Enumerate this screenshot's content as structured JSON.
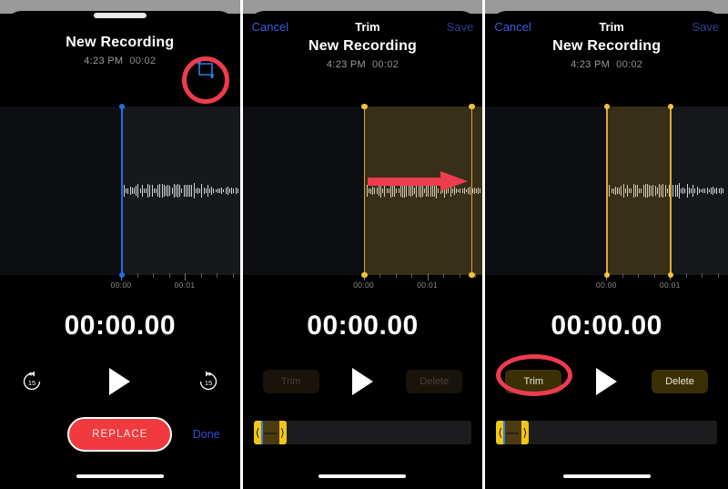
{
  "panels": [
    {
      "id": "playback",
      "navbar": {
        "visible": false,
        "cancel": "",
        "title": "",
        "save": ""
      },
      "header": {
        "title": "New Recording",
        "time": "4:23 PM",
        "duration": "00:02"
      },
      "crop_icon": {
        "name": "crop-trim-icon",
        "color": "#2f7de0",
        "annotated": true
      },
      "ruler": {
        "labels": [
          "00:00",
          "00:01"
        ]
      },
      "timer": "00:00.00",
      "transport": {
        "skip_back_label": "15",
        "skip_forward_label": "15",
        "play_label": "play"
      },
      "replace_label": "REPLACE",
      "done_label": "Done",
      "annotation": {
        "type": "ellipse",
        "color": "#ef3b4e",
        "target": "crop-trim-icon"
      }
    },
    {
      "id": "trim-drag",
      "navbar": {
        "visible": true,
        "cancel": "Cancel",
        "title": "Trim",
        "save": "Save"
      },
      "header": {
        "title": "New Recording",
        "time": "4:23 PM",
        "duration": "00:02"
      },
      "ruler": {
        "labels": [
          "00:00",
          "00:01"
        ]
      },
      "timer": "00:00.00",
      "transport": {
        "trim_label": "Trim",
        "delete_label": "Delete",
        "play_label": "play"
      },
      "annotation": {
        "type": "arrow",
        "color": "#ef3b4e",
        "direction": "right"
      }
    },
    {
      "id": "trim-ready",
      "navbar": {
        "visible": true,
        "cancel": "Cancel",
        "title": "Trim",
        "save": "Save"
      },
      "header": {
        "title": "New Recording",
        "time": "4:23 PM",
        "duration": "00:02"
      },
      "ruler": {
        "labels": [
          "00:00",
          "00:01"
        ]
      },
      "timer": "00:00.00",
      "transport": {
        "trim_label": "Trim",
        "delete_label": "Delete",
        "play_label": "play"
      },
      "annotation": {
        "type": "ellipse",
        "color": "#ef3b4e",
        "target": "trim-button"
      }
    }
  ],
  "colors": {
    "accent_blue": "#2f7de0",
    "annotation_red": "#ef3b4e",
    "trim_yellow": "#f2c33c",
    "replace_red": "#f03a3f",
    "screen_black": "#000000",
    "wave_bg": "#17181c"
  }
}
